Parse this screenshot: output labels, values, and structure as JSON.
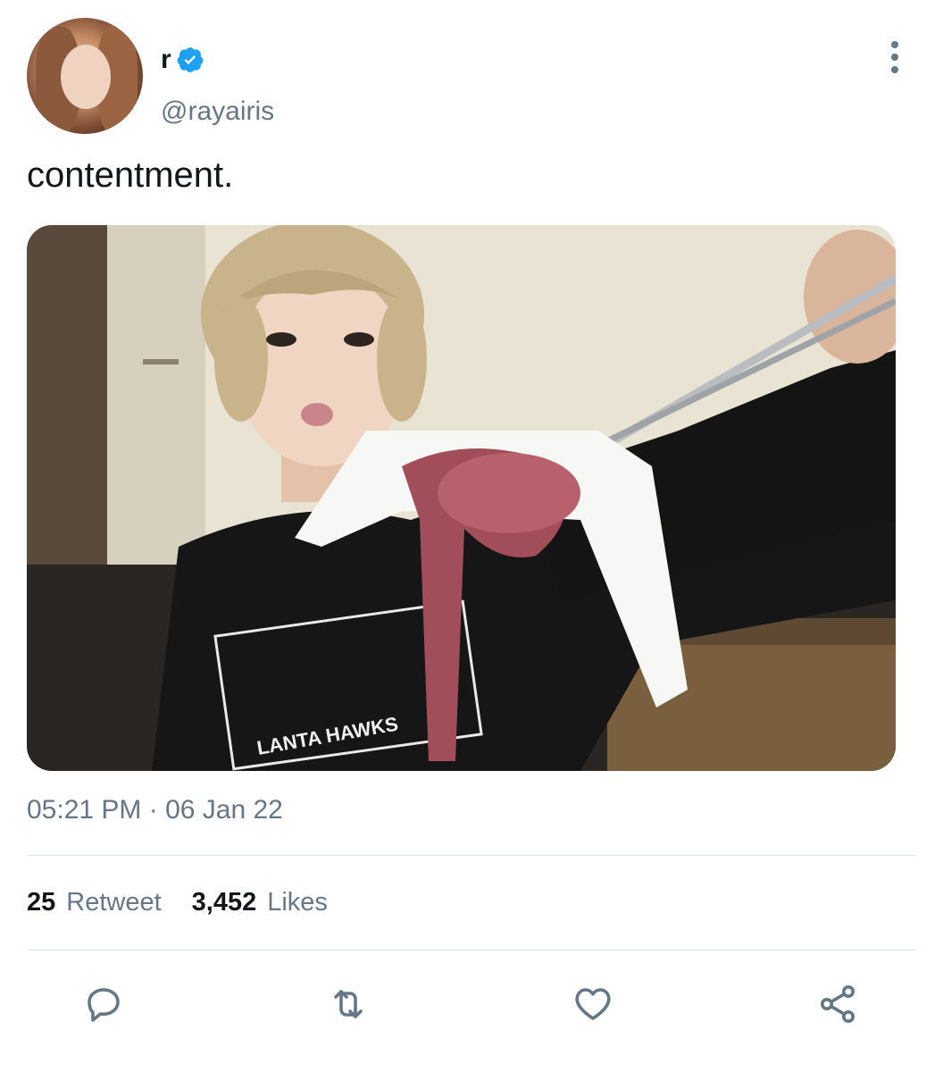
{
  "user": {
    "display_name": "r",
    "handle": "@rayairis",
    "verified": true,
    "verified_color": "#1da1f2"
  },
  "tweet": {
    "text": "contentment.",
    "timestamp": "05:21 PM · 06 Jan 22",
    "media_caption_text": "LANTA HAWKS"
  },
  "stats": {
    "retweets_count": "25",
    "retweets_label": "Retweet",
    "likes_count": "3,452",
    "likes_label": "Likes"
  },
  "actions": {
    "reply_icon": "reply-icon",
    "retweet_icon": "retweet-icon",
    "like_icon": "heart-icon",
    "share_icon": "share-icon"
  },
  "colors": {
    "secondary_text": "#657786",
    "divider": "#e1e8ed",
    "icon": "#657786"
  }
}
